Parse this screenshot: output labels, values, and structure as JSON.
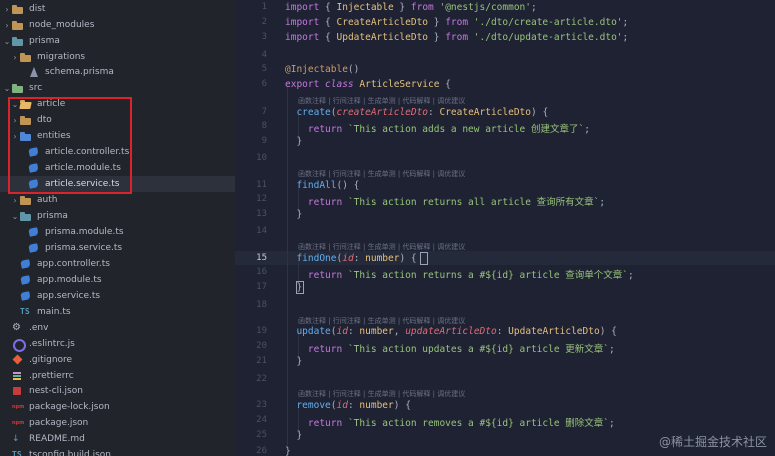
{
  "explorer": {
    "items": [
      {
        "label": "dist",
        "icon": "folder-icon",
        "chevron": "right"
      },
      {
        "label": "node_modules",
        "icon": "folder-icon",
        "chevron": "right"
      },
      {
        "label": "prisma",
        "icon": "folder-teal-icon",
        "chevron": "down"
      },
      {
        "label": "migrations",
        "icon": "folder-icon",
        "chevron": "right"
      },
      {
        "label": "schema.prisma",
        "icon": "prisma-icon",
        "chevron": ""
      },
      {
        "label": "src",
        "icon": "folder-green-icon",
        "chevron": "down"
      },
      {
        "label": "article",
        "icon": "folder-open-icon",
        "chevron": "down"
      },
      {
        "label": "dto",
        "icon": "folder-icon",
        "chevron": "right"
      },
      {
        "label": "entities",
        "icon": "folder-blue-icon",
        "chevron": "right"
      },
      {
        "label": "article.controller.ts",
        "icon": "nest-icon",
        "chevron": ""
      },
      {
        "label": "article.module.ts",
        "icon": "nest-icon",
        "chevron": ""
      },
      {
        "label": "article.service.ts",
        "icon": "nest-icon",
        "chevron": "",
        "selected": true
      },
      {
        "label": "auth",
        "icon": "folder-icon",
        "chevron": "right"
      },
      {
        "label": "prisma",
        "icon": "folder-teal-icon",
        "chevron": "down"
      },
      {
        "label": "prisma.module.ts",
        "icon": "nest-icon",
        "chevron": ""
      },
      {
        "label": "prisma.service.ts",
        "icon": "nest-icon",
        "chevron": ""
      },
      {
        "label": "app.controller.ts",
        "icon": "nest-icon",
        "chevron": ""
      },
      {
        "label": "app.module.ts",
        "icon": "nest-icon",
        "chevron": ""
      },
      {
        "label": "app.service.ts",
        "icon": "nest-icon",
        "chevron": ""
      },
      {
        "label": "main.ts",
        "icon": "ts-icon",
        "chevron": ""
      },
      {
        "label": ".env",
        "icon": "gear-icon",
        "chevron": ""
      },
      {
        "label": ".eslintrc.js",
        "icon": "eslint-icon",
        "chevron": ""
      },
      {
        "label": ".gitignore",
        "icon": "git-icon",
        "chevron": ""
      },
      {
        "label": ".prettierrc",
        "icon": "prettier-icon",
        "chevron": ""
      },
      {
        "label": "nest-cli.json",
        "icon": "nest-json-icon",
        "chevron": ""
      },
      {
        "label": "package-lock.json",
        "icon": "npm-icon",
        "chevron": ""
      },
      {
        "label": "package.json",
        "icon": "npm-icon",
        "chevron": ""
      },
      {
        "label": "README.md",
        "icon": "markdown-icon",
        "chevron": ""
      },
      {
        "label": "tsconfig.build.json",
        "icon": "tsconfig-icon",
        "chevron": ""
      }
    ]
  },
  "icon_glyphs": {
    "ts": "TS",
    "npm": "npm",
    "markdown": "↓",
    "gear": "⚙",
    "chevron_right": "›",
    "chevron_down": "⌄"
  },
  "editor": {
    "active_line": "15",
    "line_numbers": [
      "1",
      "2",
      "3",
      "4",
      "5",
      "6",
      "7",
      "8",
      "9",
      "10",
      "11",
      "12",
      "13",
      "14",
      "15",
      "16",
      "17",
      "18",
      "19",
      "20",
      "21",
      "22",
      "23",
      "24",
      "25",
      "26"
    ],
    "code_lens": "函数注释 | 行间注释 | 生成单测 | 代码解释 | 调优建议",
    "lines": [
      [
        [
          "kw",
          "import"
        ],
        [
          "pun",
          " { "
        ],
        [
          "cls",
          "Injectable"
        ],
        [
          "pun",
          " } "
        ],
        [
          "kw",
          "from"
        ],
        [
          "str",
          " '@nestjs/common'"
        ],
        [
          "pun",
          ";"
        ]
      ],
      [
        [
          "kw",
          "import"
        ],
        [
          "pun",
          " { "
        ],
        [
          "cls",
          "CreateArticleDto"
        ],
        [
          "pun",
          " } "
        ],
        [
          "kw",
          "from"
        ],
        [
          "str",
          " './dto/create-article.dto'"
        ],
        [
          "pun",
          ";"
        ]
      ],
      [
        [
          "kw",
          "import"
        ],
        [
          "pun",
          " { "
        ],
        [
          "cls",
          "UpdateArticleDto"
        ],
        [
          "pun",
          " } "
        ],
        [
          "kw",
          "from"
        ],
        [
          "str",
          " './dto/update-article.dto'"
        ],
        [
          "pun",
          ";"
        ]
      ],
      [],
      [
        [
          "dec",
          "@Injectable"
        ],
        [
          "pun",
          "()"
        ]
      ],
      [
        [
          "kw",
          "export "
        ],
        [
          "kwi",
          "class "
        ],
        [
          "cls",
          "ArticleService"
        ],
        [
          "pun",
          " {"
        ]
      ],
      [
        [
          "pun",
          "  "
        ],
        [
          "fn",
          "create"
        ],
        [
          "pun",
          "("
        ],
        [
          "prm",
          "createArticleDto"
        ],
        [
          "pun",
          ": "
        ],
        [
          "cls",
          "CreateArticleDto"
        ],
        [
          "pun",
          ") {"
        ]
      ],
      [
        [
          "pun",
          "    "
        ],
        [
          "kw",
          "return"
        ],
        [
          "str",
          " `This action adds a new article 创建文章了`"
        ],
        [
          "pun",
          ";"
        ]
      ],
      [
        [
          "pun",
          "  }"
        ]
      ],
      [],
      [
        [
          "pun",
          "  "
        ],
        [
          "fn",
          "findAll"
        ],
        [
          "pun",
          "() {"
        ]
      ],
      [
        [
          "pun",
          "    "
        ],
        [
          "kw",
          "return"
        ],
        [
          "str",
          " `This action returns all article 查询所有文章`"
        ],
        [
          "pun",
          ";"
        ]
      ],
      [
        [
          "pun",
          "  }"
        ]
      ],
      [],
      [
        [
          "pun",
          "  "
        ],
        [
          "fn",
          "findOne"
        ],
        [
          "pun",
          "("
        ],
        [
          "prm",
          "id"
        ],
        [
          "pun",
          ": "
        ],
        [
          "cls",
          "number"
        ],
        [
          "pun",
          ") {"
        ]
      ],
      [
        [
          "pun",
          "    "
        ],
        [
          "kw",
          "return"
        ],
        [
          "str",
          " `This action returns a #${id} article 查询单个文章`"
        ],
        [
          "pun",
          ";"
        ]
      ],
      [
        [
          "pun",
          "  }"
        ]
      ],
      [],
      [
        [
          "pun",
          "  "
        ],
        [
          "fn",
          "update"
        ],
        [
          "pun",
          "("
        ],
        [
          "prm",
          "id"
        ],
        [
          "pun",
          ": "
        ],
        [
          "cls",
          "number"
        ],
        [
          "pun",
          ", "
        ],
        [
          "prm",
          "updateArticleDto"
        ],
        [
          "pun",
          ": "
        ],
        [
          "cls",
          "UpdateArticleDto"
        ],
        [
          "pun",
          ") {"
        ]
      ],
      [
        [
          "pun",
          "    "
        ],
        [
          "kw",
          "return"
        ],
        [
          "str",
          " `This action updates a #${id} article 更新文章`"
        ],
        [
          "pun",
          ";"
        ]
      ],
      [
        [
          "pun",
          "  }"
        ]
      ],
      [],
      [
        [
          "pun",
          "  "
        ],
        [
          "fn",
          "remove"
        ],
        [
          "pun",
          "("
        ],
        [
          "prm",
          "id"
        ],
        [
          "pun",
          ": "
        ],
        [
          "cls",
          "number"
        ],
        [
          "pun",
          ") {"
        ]
      ],
      [
        [
          "pun",
          "    "
        ],
        [
          "kw",
          "return"
        ],
        [
          "str",
          " `This action removes a #${id} article 删除文章`"
        ],
        [
          "pun",
          ";"
        ]
      ],
      [
        [
          "pun",
          "  }"
        ]
      ],
      [
        [
          "pun",
          "}"
        ]
      ]
    ]
  },
  "watermark": "@稀土掘金技术社区"
}
